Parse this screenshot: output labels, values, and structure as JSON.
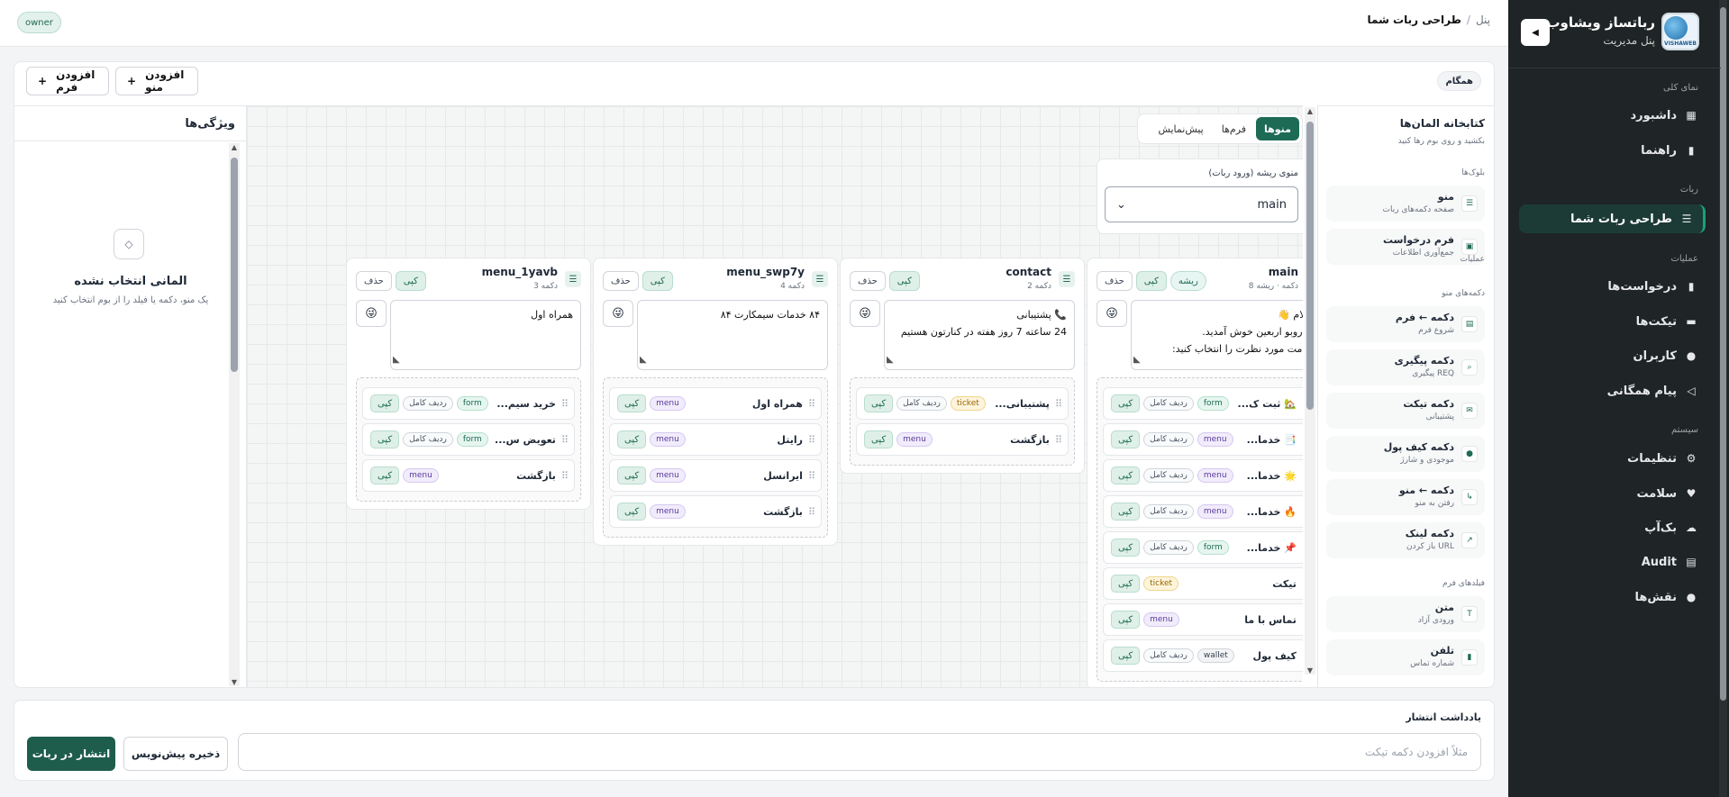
{
  "topbar": {
    "owner_badge": "owner",
    "breadcrumb_home": "پنل",
    "breadcrumb_sep": "/",
    "breadcrumb_current": "طراحی ربات شما"
  },
  "sidebar": {
    "brand_title": "رباتساز ویشاوب",
    "brand_subtitle": "پنل مدیریت",
    "logo_text": "VISHAWEB",
    "sections": {
      "overview": "نمای کلی",
      "bot": "ربات",
      "operations": "عملیات",
      "system": "سیستم"
    },
    "items": [
      {
        "label": "داشبورد",
        "icon": "dashboard-icon",
        "glyph": "▦"
      },
      {
        "label": "راهنما",
        "icon": "book-icon",
        "glyph": "▮"
      },
      {
        "label": "طراحی ربات شما",
        "icon": "list-icon",
        "glyph": "☰"
      },
      {
        "label": "درخواست‌ها",
        "icon": "bookmark-icon",
        "glyph": "▮"
      },
      {
        "label": "تیکت‌ها",
        "icon": "ticket-icon",
        "glyph": "▬"
      },
      {
        "label": "کاربران",
        "icon": "user-icon",
        "glyph": "●"
      },
      {
        "label": "پیام همگانی",
        "icon": "broadcast-icon",
        "glyph": "◁"
      },
      {
        "label": "تنظیمات",
        "icon": "gear-icon",
        "glyph": "⚙"
      },
      {
        "label": "سلامت",
        "icon": "heart-icon",
        "glyph": "♥"
      },
      {
        "label": "بک‌آپ",
        "icon": "cloud-icon",
        "glyph": "☁"
      },
      {
        "label": "Audit",
        "icon": "clipboard-icon",
        "glyph": "▤"
      },
      {
        "label": "نقش‌ها",
        "icon": "chat-icon",
        "glyph": "●"
      }
    ]
  },
  "toolbar": {
    "add_menu": "افزودن منو",
    "add_form": "افزودن فرم",
    "plus": "+",
    "sync_badge": "همگام"
  },
  "properties": {
    "title": "ویژگی‌ها",
    "empty_title": "المانی انتخاب نشده",
    "empty_sub": "یک منو، دکمه یا فیلد را از بوم انتخاب کنید",
    "empty_icon": "◇"
  },
  "tabs": {
    "menus": "منوها",
    "forms": "فرم‌ها",
    "preview": "پیش‌نمایش"
  },
  "root_menu": {
    "label": "منوی ریشه (ورود ربات)",
    "value": "main"
  },
  "common": {
    "copy": "کپی",
    "delete": "حذف",
    "root": "ریشه",
    "full_row": "ردیف کامل",
    "emoji": "😜",
    "drag": "⠿",
    "resize": "◣"
  },
  "menus": [
    {
      "name": "main",
      "sub": "8 دکمه · ریشه",
      "text": "سلام 👋\nبه روبو اربعین خوش آمدید.\nخدمت مورد نظرت را انتخاب کنید:",
      "buttons": [
        {
          "name": "🏡 ثبت ک...",
          "type": "form",
          "full": true
        },
        {
          "name": "📑 خدما...",
          "type": "menu",
          "full": true
        },
        {
          "name": "🌟 خدما...",
          "type": "menu",
          "full": true
        },
        {
          "name": "🔥 خدما...",
          "type": "menu",
          "full": true
        },
        {
          "name": "📌 خدما...",
          "type": "form",
          "full": true
        },
        {
          "name": "تیکت",
          "type": "ticket",
          "full": false
        },
        {
          "name": "تماس با ما",
          "type": "menu",
          "full": false
        },
        {
          "name": "کیف پول",
          "type": "wallet",
          "full": true
        }
      ]
    },
    {
      "name": "contact",
      "sub": "2 دکمه",
      "text": "📞 پشتیبانی\n24 ساعته 7 روز هفته در کنارتون هستیم",
      "buttons": [
        {
          "name": "پشتیبانی...",
          "type": "ticket",
          "full": true
        },
        {
          "name": "بازگشت",
          "type": "menu",
          "full": false
        }
      ]
    },
    {
      "name": "menu_swp7y",
      "sub": "4 دکمه",
      "text": "۸۴ خدمات سیمکارت ۸۴",
      "buttons": [
        {
          "name": "همراه اول",
          "type": "menu",
          "full": false
        },
        {
          "name": "رایتل",
          "type": "menu",
          "full": false
        },
        {
          "name": "ایرانسل",
          "type": "menu",
          "full": false
        },
        {
          "name": "بازگشت",
          "type": "menu",
          "full": false
        }
      ]
    },
    {
      "name": "menu_1yavb",
      "sub": "3 دکمه",
      "text": "همراه اول",
      "buttons": [
        {
          "name": "خرید سیم...",
          "type": "form",
          "full": true
        },
        {
          "name": "تعویض س...",
          "type": "form",
          "full": true
        },
        {
          "name": "بازگشت",
          "type": "menu",
          "full": false
        }
      ]
    }
  ],
  "library": {
    "title": "کتابخانه المان‌ها",
    "subtitle": "بکشید و روی بوم رها کنید",
    "sections": {
      "blocks": "بلوک‌ها",
      "ops": "عملیات",
      "menu_buttons": "دکمه‌های منو",
      "form_fields": "فیلدهای فرم"
    },
    "blocks": [
      {
        "name": "منو",
        "desc": "صفحه دکمه‌های ربات",
        "icon": "menu-block-icon",
        "glyph": "☰"
      },
      {
        "name": "فرم درخواست",
        "desc": "جمع‌آوری اطلاعات",
        "icon": "form-block-icon",
        "glyph": "▣"
      }
    ],
    "buttons": [
      {
        "name": "دکمه ← فرم",
        "desc": "شروع فرم",
        "icon": "form-button-icon",
        "glyph": "▤"
      },
      {
        "name": "دکمه پیگیری",
        "desc": "پیگیری REQ",
        "icon": "track-button-icon",
        "glyph": "⌕"
      },
      {
        "name": "دکمه تیکت",
        "desc": "پشتیبانی",
        "icon": "ticket-button-icon",
        "glyph": "✉"
      },
      {
        "name": "دکمه کیف پول",
        "desc": "موجودی و شارژ",
        "icon": "wallet-button-icon",
        "glyph": "●"
      },
      {
        "name": "دکمه ← منو",
        "desc": "رفتن به منو",
        "icon": "menu-button-icon",
        "glyph": "↳"
      },
      {
        "name": "دکمه لینک",
        "desc": "باز کردن URL",
        "icon": "link-button-icon",
        "glyph": "↗"
      }
    ],
    "fields": [
      {
        "name": "متن",
        "desc": "ورودی آزاد",
        "icon": "text-field-icon",
        "glyph": "T"
      },
      {
        "name": "تلفن",
        "desc": "شماره تماس",
        "icon": "phone-field-icon",
        "glyph": "▮"
      }
    ]
  },
  "publish": {
    "note_label": "یادداشت انتشار",
    "note_placeholder": "مثلاً افزودن دکمه تیکت",
    "save_draft": "ذخیره پیش‌نویس",
    "publish": "انتشار در ربات"
  },
  "colors": {
    "accent": "#1e6b55",
    "sidebar_bg": "#1f2426",
    "active_indicator": "#18a17a"
  }
}
